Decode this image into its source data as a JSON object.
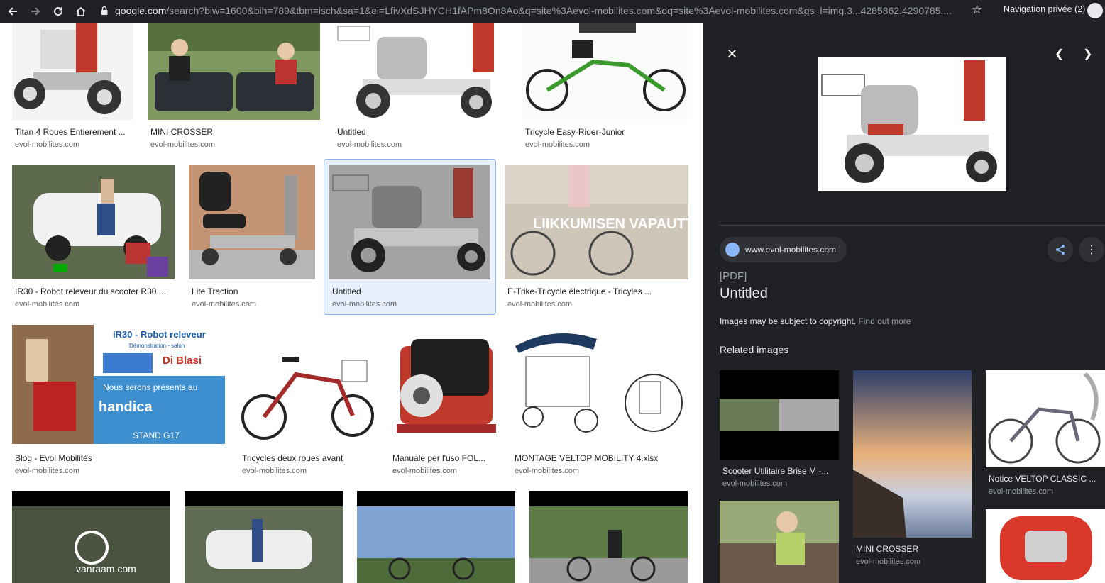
{
  "browser": {
    "url_domain": "google.com",
    "url_rest": "/search?biw=1600&bih=789&tbm=isch&sa=1&ei=LfivXdSJHYCH1fAPm8On8Ao&q=site%3Aevol-mobilites.com&oq=site%3Aevol-mobilites.com&gs_l=img.3...4285862.4290785....",
    "incognito_label": "Navigation privée (2)"
  },
  "results": [
    {
      "caption": "Titan 4 Roues Entierement ...",
      "source": "evol-mobilites.com"
    },
    {
      "caption": "MINI CROSSER",
      "source": "evol-mobilites.com"
    },
    {
      "caption": "Untitled",
      "source": "evol-mobilites.com"
    },
    {
      "caption": "Tricycle Easy-Rider-Junior",
      "source": "evol-mobilites.com"
    },
    {
      "caption": "IR30 - Robot releveur du scooter R30 ...",
      "source": "evol-mobilites.com"
    },
    {
      "caption": "Lite Traction",
      "source": "evol-mobilites.com"
    },
    {
      "caption": "Untitled",
      "source": "evol-mobilites.com"
    },
    {
      "caption": "E-Trike-Tricycle électrique - Tricyles ...",
      "source": "evol-mobilites.com"
    },
    {
      "caption": "Blog - Evol Mobilités",
      "source": "evol-mobilites.com"
    },
    {
      "caption": "Tricycles deux roues avant",
      "source": "evol-mobilites.com"
    },
    {
      "caption": "Manuale per l'uso FOL...",
      "source": "evol-mobilites.com"
    },
    {
      "caption": "MONTAGE VELTOP MOBILITY 4.xlsx",
      "source": "evol-mobilites.com"
    }
  ],
  "thumb_text": {
    "finnish": "LIIKKUMISEN VAPAUTTA",
    "banner_title": "IR30 - Robot releveur",
    "banner_sub": "Démonstration - salon",
    "banner_brand": "Di Blasi",
    "banner_msg": "Nous serons présents au",
    "banner_event": "handica",
    "banner_stand": "STAND G17",
    "vanraam": "vanraam.com"
  },
  "panel": {
    "site": "www.evol-mobilites.com",
    "type": "[PDF]",
    "title": "Untitled",
    "copyright": "Images may be subject to copyright.",
    "find_more": "Find out more",
    "related_heading": "Related images",
    "related": [
      {
        "caption": "Scooter Utilitaire Brise M -...",
        "source": "evol-mobilites.com"
      },
      {
        "caption": "MINI CROSSER",
        "source": "evol-mobilites.com"
      },
      {
        "caption": "Notice VELTOP CLASSIC ...",
        "source": "evol-mobilites.com"
      }
    ]
  }
}
